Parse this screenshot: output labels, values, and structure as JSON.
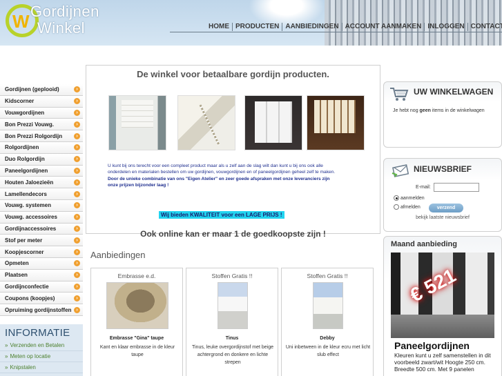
{
  "header": {
    "logo_line1": "Gordijnen",
    "logo_line2": "Winkel",
    "logo_mark": "W",
    "nav": [
      "HOME",
      "PRODUCTEN",
      "AANBIEDINGEN",
      "ACCOUNT AANMAKEN",
      "INLOGGEN",
      "CONTACT"
    ]
  },
  "sidebar": {
    "items": [
      "Gordijnen (geplooid)",
      "Kidscorner",
      "Vouwgordijnen",
      "Bon Prezzi Vouwg.",
      "Bon Prezzi Rolgordijn",
      "Rolgordijnen",
      "Duo Rolgordijn",
      "Paneelgordijnen",
      "Houten Jaloezieën",
      "Lamellendecors",
      "Vouwg. systemen",
      "Vouwg. accessoires",
      "Gordijnaccessoires",
      "Stof per meter",
      "Koopjescorner",
      "Opmeten",
      "Plaatsen",
      "Gordijnconfectie",
      "Coupons (koopjes)",
      "Opruiming gordijnstoffen"
    ],
    "arrow_icon": "arrow-right-icon",
    "info_title": "INFORMATIE",
    "info_links": [
      "Verzenden en Betalen",
      "Meten op locatie",
      "Knipstalen"
    ]
  },
  "main": {
    "welcome_title": "De winkel voor betaalbare gordijn producten.",
    "intro_1": "U kunt bij ons terecht voor een compleet product maar als u zelf aan de slag wilt dan kunt u bij ons ook  alle onderdelen en materialen bestellen om uw gordijnen, vouwgordijnen en of paneelgordijnen geheel zelf te maken.",
    "intro_2": "Door de unieke combinatie van ons \"Eigen Atelier\" en zeer goede  afspraken met onze leveranciers zijn onze prijzen bijzonder laag !",
    "quality": "Wij bieden KWALITEIT voor een LAGE PRIJS !",
    "online": "Ook online kan er maar 1 de goedkoopste zijn !",
    "offers_title": "Aanbiedingen",
    "offers": [
      {
        "heading": "Embrasse e.d.",
        "title": "Embrasse \"Gina\" taupe",
        "description": "Kant en klaar embrasse in de kleur taupe"
      },
      {
        "heading": "Stoffen Gratis !!",
        "title": "Tinus",
        "description": "Tinus, leuke overgordijnstof met beige achtergrond en donkere en lichte strepen"
      },
      {
        "heading": "Stoffen Gratis !!",
        "title": "Debby",
        "description": "Uni inbetween in de kleur ecru met licht slub effect"
      }
    ]
  },
  "right": {
    "cart_title": "UW WINKELWAGEN",
    "cart_text_pre": "Je hebt nog ",
    "cart_text_bold": "geen",
    "cart_text_post": " items in de winkelwagen",
    "news_title": "NIEUWSBRIEF",
    "email_label": "E-mail:",
    "email_value": "",
    "radio_subscribe": "aanmelden",
    "radio_unsubscribe": "afmelden",
    "submit": "verzend",
    "archive": "bekijk laatste nieuwsbrief",
    "month_title": "Maand aanbieding",
    "month_price": "€ 521",
    "month_product": "Paneelgordijnen",
    "month_desc": "Kleuren kunt u zelf samenstellen in dit voorbeeld zwart/wit Hoogte 250 cm. Breedte 500 cm. Met 9 panelen"
  }
}
